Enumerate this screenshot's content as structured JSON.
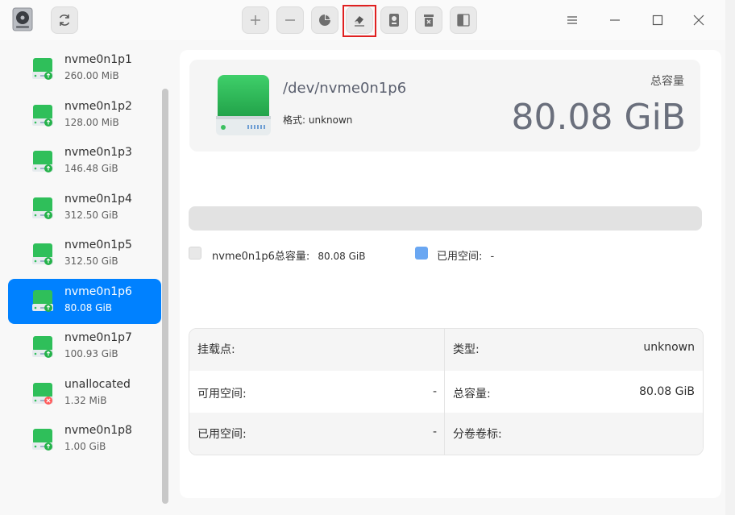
{
  "toolbar": {
    "buttons": [
      {
        "icon": "plus-icon"
      },
      {
        "icon": "minus-icon"
      },
      {
        "icon": "pie-chart-icon"
      },
      {
        "icon": "eraser-icon"
      },
      {
        "icon": "mount-icon"
      },
      {
        "icon": "unmount-icon"
      },
      {
        "icon": "resize-icon"
      }
    ]
  },
  "partitions": [
    {
      "name": "nvme0n1p1",
      "size": "260.00 MiB",
      "status": "ok"
    },
    {
      "name": "nvme0n1p2",
      "size": "128.00 MiB",
      "status": "ok"
    },
    {
      "name": "nvme0n1p3",
      "size": "146.48 GiB",
      "status": "ok"
    },
    {
      "name": "nvme0n1p4",
      "size": "312.50 GiB",
      "status": "ok"
    },
    {
      "name": "nvme0n1p5",
      "size": "312.50 GiB",
      "status": "ok"
    },
    {
      "name": "nvme0n1p6",
      "size": "80.08 GiB",
      "status": "ok",
      "selected": true
    },
    {
      "name": "nvme0n1p7",
      "size": "100.93 GiB",
      "status": "ok"
    },
    {
      "name": "unallocated",
      "size": "1.32 MiB",
      "status": "error"
    },
    {
      "name": "nvme0n1p8",
      "size": "1.00 GiB",
      "status": "ok"
    }
  ],
  "detail": {
    "device_path": "/dev/nvme0n1p6",
    "format_label": "格式:",
    "format_value": "unknown",
    "capacity_label": "总容量",
    "capacity_value": "80.08 GiB"
  },
  "legend": {
    "total_label": "nvme0n1p6总容量:",
    "total_value": "80.08 GiB",
    "used_label": "已用空间:",
    "used_value": "-"
  },
  "table": {
    "mount_label": "挂载点:",
    "mount_value": "",
    "type_label": "类型:",
    "type_value": "unknown",
    "avail_label": "可用空间:",
    "avail_value": "-",
    "total_label": "总容量:",
    "total_value": "80.08 GiB",
    "used_label": "已用空间:",
    "used_value": "-",
    "vol_label": "分卷卷标:",
    "vol_value": ""
  },
  "colors": {
    "accent": "#0081ff",
    "disk_green": "#2bb553",
    "used_blue": "#6aa7f2",
    "total_gray": "#e4e4e4"
  }
}
